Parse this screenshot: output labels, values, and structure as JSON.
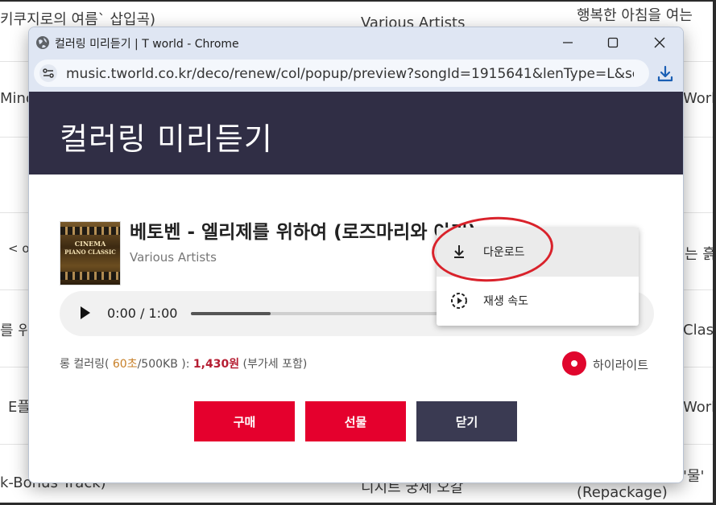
{
  "background": {
    "rows": [
      {
        "left": "키쿠지로의 여름` 삽입곡)",
        "mid": "Various Artists",
        "right": "행복한 아침을 여는"
      },
      {
        "left": "Mino",
        "right": "Work"
      },
      {
        "left": "< o",
        "right": "는 흙"
      },
      {
        "left": "를 위",
        "right": "Clas"
      },
      {
        "left": "E플",
        "right": "Work"
      },
      {
        "left": "k-Bonus Track)",
        "mid": "디지트 궁제 오갈",
        "right": "(Repackage)",
        "right2": "'물'"
      }
    ]
  },
  "window": {
    "title": "컬러링 미리듣기 | T world - Chrome",
    "url": "music.tworld.co.kr/deco/renew/col/popup/preview?songId=1915641&lenType=L&secti...",
    "icons": {
      "favicon": "globe-icon",
      "site_info": "site-info-icon",
      "download": "download-icon",
      "minimize": "minimize-icon",
      "maximize": "maximize-icon",
      "close": "close-icon"
    }
  },
  "popup": {
    "header_title": "컬러링 미리듣기",
    "album_art": {
      "line1": "CINEMA",
      "line2": "PIANO CLASSIC"
    },
    "song_title": "베토벤 - 엘리제를 위하여 (로즈마리와 아기)",
    "artist": "Various Artists",
    "player": {
      "time": "0:00 / 1:00",
      "progress": 0.3
    },
    "info": {
      "prefix": "롱 컬러링(",
      "seconds": "60초",
      "size": "/500KB ): ",
      "price": "1,430원",
      "suffix": " (부가세 포함)"
    },
    "highlight_label": "하이라이트",
    "buttons": {
      "buy": "구매",
      "gift": "선물",
      "close": "닫기"
    }
  },
  "context_menu": {
    "items": [
      {
        "label": "다운로드",
        "icon": "download-icon"
      },
      {
        "label": "재생 속도",
        "icon": "playback-speed-icon"
      }
    ]
  },
  "colors": {
    "header_bg": "#302e45",
    "accent_red": "#e5002d",
    "dark_button": "#3a3a52",
    "price": "#b51d32",
    "seconds": "#c77f27"
  }
}
